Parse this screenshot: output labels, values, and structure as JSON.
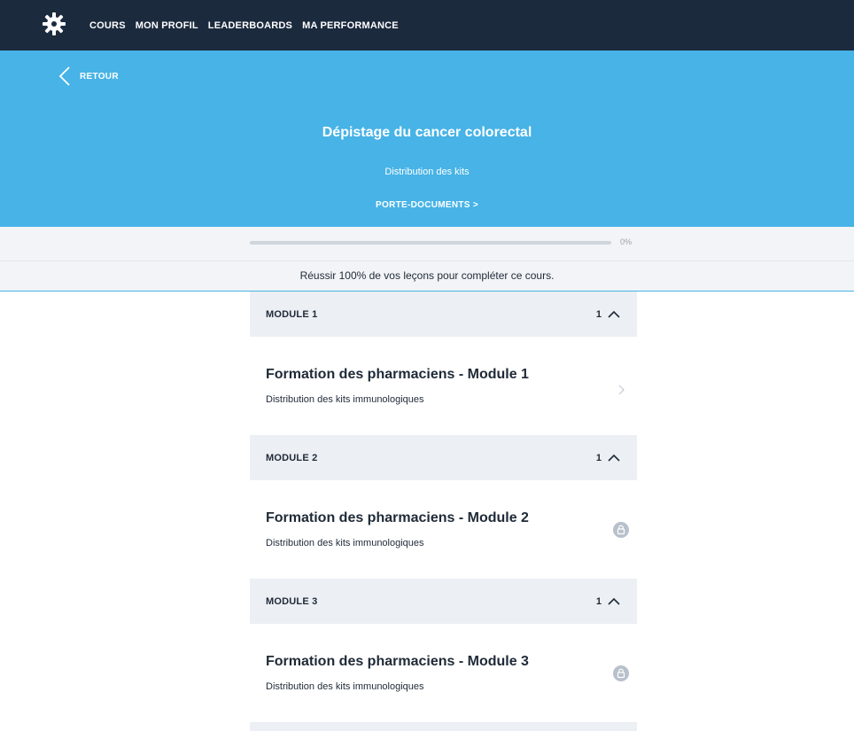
{
  "nav": {
    "items": [
      "COURS",
      "MON PROFIL",
      "LEADERBOARDS",
      "MA PERFORMANCE"
    ]
  },
  "hero": {
    "back_label": "RETOUR",
    "title": "Dépistage du cancer colorectal",
    "subtitle": "Distribution des kits",
    "link_label": "PORTE-DOCUMENTS >"
  },
  "progress": {
    "value": 0,
    "label": "0%",
    "note": "Réussir 100% de vos leçons pour compléter ce cours."
  },
  "modules": [
    {
      "header": "MODULE 1",
      "count": "1",
      "lesson": {
        "title": "Formation des pharmaciens - Module 1",
        "subtitle": "Distribution des kits immunologiques",
        "state": "available",
        "icon": "chevron-right-icon"
      }
    },
    {
      "header": "MODULE 2",
      "count": "1",
      "lesson": {
        "title": "Formation des pharmaciens - Module 2",
        "subtitle": "Distribution des kits immunologiques",
        "state": "locked",
        "icon": "lock-icon"
      }
    },
    {
      "header": "MODULE 3",
      "count": "1",
      "lesson": {
        "title": "Formation des pharmaciens - Module 3",
        "subtitle": "Distribution des kits immunologiques",
        "state": "locked",
        "icon": "lock-icon"
      }
    }
  ],
  "colors": {
    "nav_bg": "#1c2a3e",
    "hero_bg": "#47b3e6",
    "band_bg": "#f2f4f7",
    "module_header_bg": "#eceff3",
    "lock": "#b8c1cb"
  }
}
